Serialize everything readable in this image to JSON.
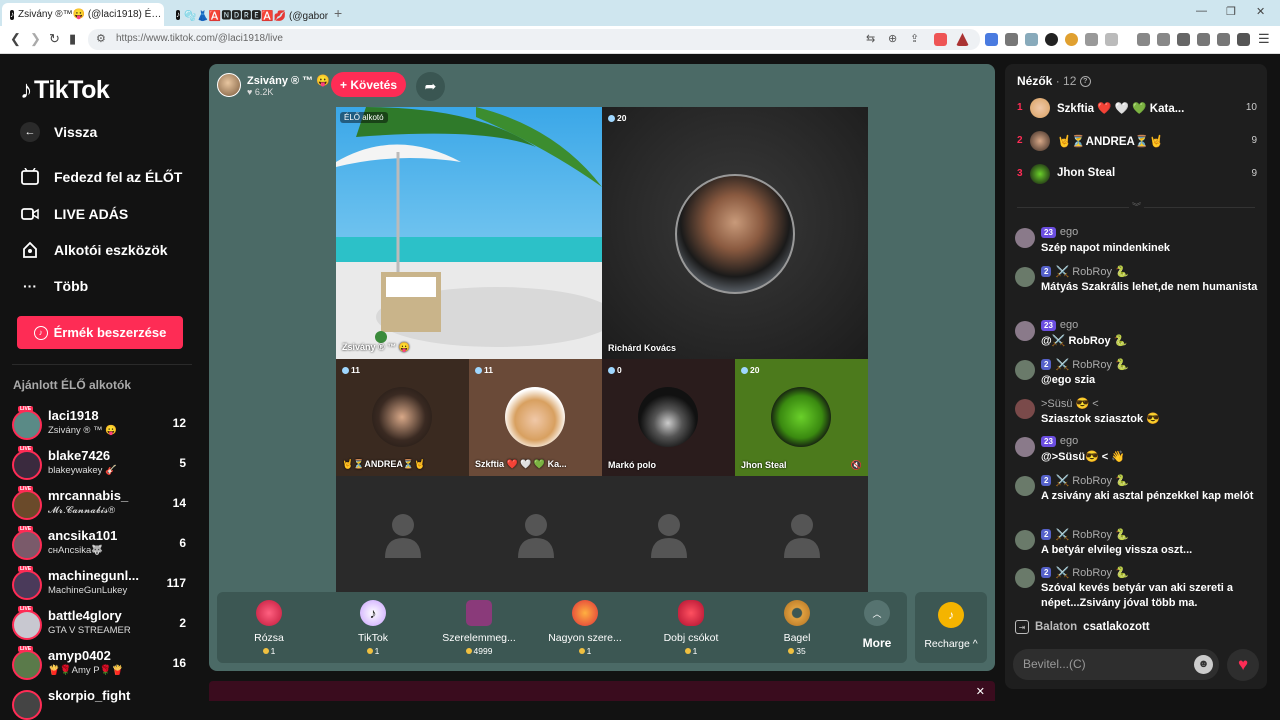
{
  "browser": {
    "tabs": [
      {
        "title": "Zsivány ®™😛 (@laci1918) É…"
      },
      {
        "title": "🫧👗🅰️🅽🅳🆁🅴🅰️💋 (@gabor"
      }
    ],
    "url": "https://www.tiktok.com/@laci1918/live",
    "new_tab": "+",
    "back": "❮",
    "forward": "❯",
    "reload": "↻"
  },
  "sidebar": {
    "logo": "TikTok",
    "back_label": "Vissza",
    "nav": [
      {
        "label": "Fedezd fel az ÉLŐT",
        "icon": "live-tv-icon"
      },
      {
        "label": "LIVE ADÁS",
        "icon": "camera-icon"
      },
      {
        "label": "Alkotói eszközök",
        "icon": "lightbulb-icon"
      },
      {
        "label": "Több",
        "icon": "more-icon"
      }
    ],
    "coins_button": "Érmék beszerzése",
    "recommended_heading": "Ajánlott ÉLŐ alkotók",
    "live_badge": "LIVE",
    "creators": [
      {
        "name": "laci1918",
        "sub": "Zsivány ® ™ 😛",
        "count": "12",
        "color": "#5a8a86"
      },
      {
        "name": "blake7426",
        "sub": "blakeywakey 🎸",
        "count": "5",
        "color": "#3a2a3e"
      },
      {
        "name": "mrcannabis_",
        "sub": "𝓜𝓻.𝓒𝓪𝓷𝓷𝓪𝓫𝓲𝓼®",
        "count": "14",
        "color": "#6a4a2a"
      },
      {
        "name": "ancsika101",
        "sub": "ᴄнAncsika🐺",
        "count": "6",
        "color": "#7a5a6a"
      },
      {
        "name": "machinegunl...",
        "sub": "MachineGunLukey",
        "count": "117",
        "color": "#4a3a5a"
      },
      {
        "name": "battle4glory",
        "sub": "GTA V STREAMER",
        "count": "2",
        "color": "#c8c8d0"
      },
      {
        "name": "amyp0402",
        "sub": "🍟🌹Amy P🌹🍟",
        "count": "16",
        "color": "#5a7a4a"
      },
      {
        "name": "skorpio_fight",
        "sub": "",
        "count": "",
        "color": "#444"
      }
    ]
  },
  "stream": {
    "host_name": "Zsivány ® ™ 😛",
    "host_likes": "♥ 6.2K",
    "follow_label": "+ Követés",
    "share_icon": "➦",
    "elo_label": "ÉLŐ alkotó",
    "host_tile_label": "Zsivány ® ™ 😛",
    "tiles": [
      {
        "viewers": "20",
        "label": "Richárd Kovács"
      },
      {
        "viewers": "11",
        "label": "🤘⏳ANDREA⏳🤘"
      },
      {
        "viewers": "11",
        "label": "Szkftia ❤️ 🤍 💚 Ka..."
      },
      {
        "viewers": "0",
        "label": "Markó polo"
      },
      {
        "viewers": "20",
        "label": "Jhon Steal"
      }
    ],
    "gifts": [
      {
        "name": "Rózsa",
        "price": "1",
        "icon": "rose-icon"
      },
      {
        "name": "TikTok",
        "price": "1",
        "icon": "tiktok-gift-icon"
      },
      {
        "name": "Szerelemmeg...",
        "price": "4999",
        "icon": "love-box-icon"
      },
      {
        "name": "Nagyon szere...",
        "price": "1",
        "icon": "heart-hug-icon"
      },
      {
        "name": "Dobj csókot",
        "price": "1",
        "icon": "kiss-icon"
      },
      {
        "name": "Bagel",
        "price": "35",
        "icon": "bagel-icon"
      }
    ],
    "more_label": "More",
    "recharge_label": "Recharge ^"
  },
  "chat": {
    "viewers_label": "Nézők",
    "viewers_count": "· 12",
    "top_viewers": [
      {
        "rank": "1",
        "name": "Szkftia ❤️ 🤍 💚 Kata...",
        "score": "10"
      },
      {
        "rank": "2",
        "name": "🤘⏳ANDREA⏳🤘",
        "score": "9"
      },
      {
        "rank": "3",
        "name": "Jhon Steal",
        "score": "9"
      }
    ],
    "messages": [
      {
        "badge": "23",
        "user": "ego",
        "text": "Szép napot mindenkinek"
      },
      {
        "badge": "2",
        "user": "⚔️ RobRoy 🐍",
        "text": "Mátyás Szakrális lehet,de nem humanista"
      },
      {
        "badge": "23",
        "user": "ego",
        "text": "@⚔️ RobRoy 🐍"
      },
      {
        "badge": "2",
        "user": "⚔️ RobRoy 🐍",
        "text": "@ego szia"
      },
      {
        "badge": "",
        "user": ">Süsü 😎 <",
        "text": "Sziasztok sziasztok 😎"
      },
      {
        "badge": "23",
        "user": "ego",
        "text": "@>Süsü😎 < 👋"
      },
      {
        "badge": "2",
        "user": "⚔️ RobRoy 🐍",
        "text": "A zsivány aki asztal pénzekkel kap melót"
      },
      {
        "badge": "2",
        "user": "⚔️ RobRoy 🐍",
        "text": "A betyár elvileg vissza oszt..."
      },
      {
        "badge": "2",
        "user": "⚔️ RobRoy 🐍",
        "text": "Szóval kevés betyár van aki szereti a népet...Zsivány jóval több ma."
      }
    ],
    "join_user": "Balaton",
    "join_text": "csatlakozott",
    "input_placeholder": "Bevitel...(C)"
  },
  "colors": {
    "accent": "#fe2c55",
    "stage_bg": "#4b6a66",
    "gift_bar": "#3c5753"
  }
}
